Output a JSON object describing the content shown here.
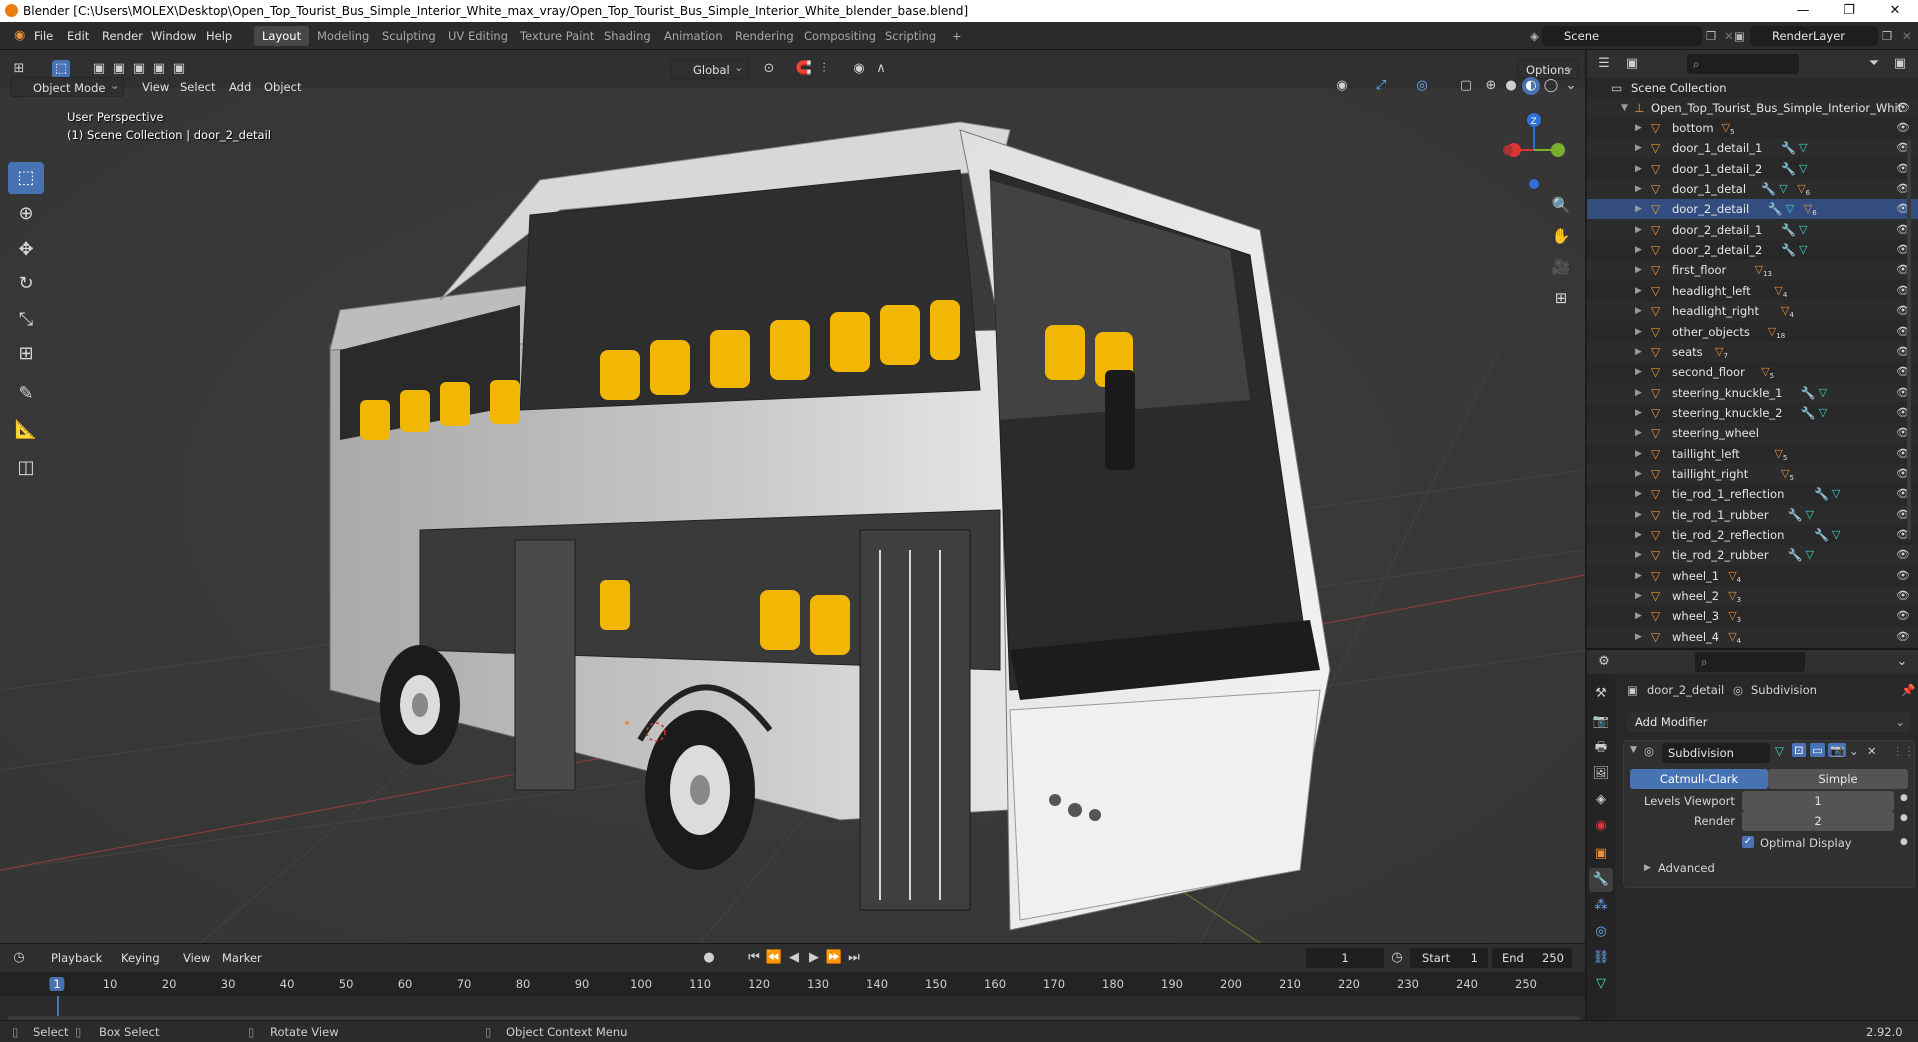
{
  "window": {
    "title": "Blender [C:\\Users\\MOLEX\\Desktop\\Open_Top_Tourist_Bus_Simple_Interior_White_max_vray/Open_Top_Tourist_Bus_Simple_Interior_White_blender_base.blend]",
    "minimize": "—",
    "maximize": "❐",
    "close": "✕"
  },
  "menu": {
    "file": "File",
    "edit": "Edit",
    "render": "Render",
    "window": "Window",
    "help": "Help"
  },
  "workspaces": [
    "Layout",
    "Modeling",
    "Sculpting",
    "UV Editing",
    "Texture Paint",
    "Shading",
    "Animation",
    "Rendering",
    "Compositing",
    "Scripting"
  ],
  "active_workspace": "Layout",
  "add_workspace": "+",
  "scene": {
    "label": "Scene",
    "render_layer": "RenderLayer"
  },
  "viewport": {
    "mode": "Object Mode",
    "menus": [
      "View",
      "Select",
      "Add",
      "Object"
    ],
    "transform_orientation": "Global",
    "options": "Options",
    "perspective": "User Perspective",
    "collection_info": "(1) Scene Collection | door_2_detail",
    "gizmo": {
      "z": "Z"
    }
  },
  "timeline": {
    "menus": [
      "Playback",
      "Keying",
      "View",
      "Marker"
    ],
    "current_frame": "1",
    "start_label": "Start",
    "start": "1",
    "end_label": "End",
    "end": "250",
    "ticks": [
      "1",
      "10",
      "20",
      "30",
      "40",
      "50",
      "60",
      "70",
      "80",
      "90",
      "100",
      "110",
      "120",
      "130",
      "140",
      "150",
      "160",
      "170",
      "180",
      "190",
      "200",
      "210",
      "220",
      "230",
      "240",
      "250"
    ]
  },
  "statusbar": {
    "select": "Select",
    "box_select": "Box Select",
    "rotate_view": "Rotate View",
    "context_menu": "Object Context Menu",
    "version": "2.92.0"
  },
  "outliner": {
    "root": "Scene Collection",
    "collection": "Open_Top_Tourist_Bus_Simple_Interior_Whit",
    "items": [
      {
        "name": "bottom",
        "badge": "5",
        "mods": false
      },
      {
        "name": "door_1_detail_1",
        "badge": "",
        "mods": true
      },
      {
        "name": "door_1_detail_2",
        "badge": "",
        "mods": true
      },
      {
        "name": "door_1_detal",
        "badge": "6",
        "mods": true
      },
      {
        "name": "door_2_detail",
        "badge": "6",
        "mods": true
      },
      {
        "name": "door_2_detail_1",
        "badge": "",
        "mods": true
      },
      {
        "name": "door_2_detail_2",
        "badge": "",
        "mods": true
      },
      {
        "name": "first_floor",
        "badge": "13",
        "mods": false
      },
      {
        "name": "headlight_left",
        "badge": "4",
        "mods": false
      },
      {
        "name": "headlight_right",
        "badge": "4",
        "mods": false
      },
      {
        "name": "other_objects",
        "badge": "18",
        "mods": false
      },
      {
        "name": "seats",
        "badge": "7",
        "mods": false
      },
      {
        "name": "second_floor",
        "badge": "5",
        "mods": false
      },
      {
        "name": "steering_knuckle_1",
        "badge": "",
        "mods": true
      },
      {
        "name": "steering_knuckle_2",
        "badge": "",
        "mods": true
      },
      {
        "name": "steering_wheel",
        "badge": "",
        "mods": false
      },
      {
        "name": "taillight_left",
        "badge": "5",
        "mods": false
      },
      {
        "name": "taillight_right",
        "badge": "5",
        "mods": false
      },
      {
        "name": "tie_rod_1_reflection",
        "badge": "",
        "mods": true
      },
      {
        "name": "tie_rod_1_rubber",
        "badge": "",
        "mods": true
      },
      {
        "name": "tie_rod_2_reflection",
        "badge": "",
        "mods": true
      },
      {
        "name": "tie_rod_2_rubber",
        "badge": "",
        "mods": true
      },
      {
        "name": "wheel_1",
        "badge": "4",
        "mods": false
      },
      {
        "name": "wheel_2",
        "badge": "3",
        "mods": false
      },
      {
        "name": "wheel_3",
        "badge": "3",
        "mods": false
      },
      {
        "name": "wheel_4",
        "badge": "4",
        "mods": false
      }
    ]
  },
  "properties": {
    "object_name": "door_2_detail",
    "modifier_breadcrumb": "Subdivision",
    "add_modifier": "Add Modifier",
    "modifier_name": "Subdivision",
    "catmull_clark": "Catmull-Clark",
    "simple": "Simple",
    "levels_viewport_label": "Levels Viewport",
    "levels_viewport": "1",
    "render_label": "Render",
    "render": "2",
    "optimal_display": "Optimal Display",
    "advanced": "Advanced"
  },
  "colors": {
    "accent": "#4772b3",
    "selection": "#334d80",
    "object_orange": "#e8903e",
    "modifier_blue": "#6fb0ff",
    "mesh_teal": "#3fd9c9"
  }
}
